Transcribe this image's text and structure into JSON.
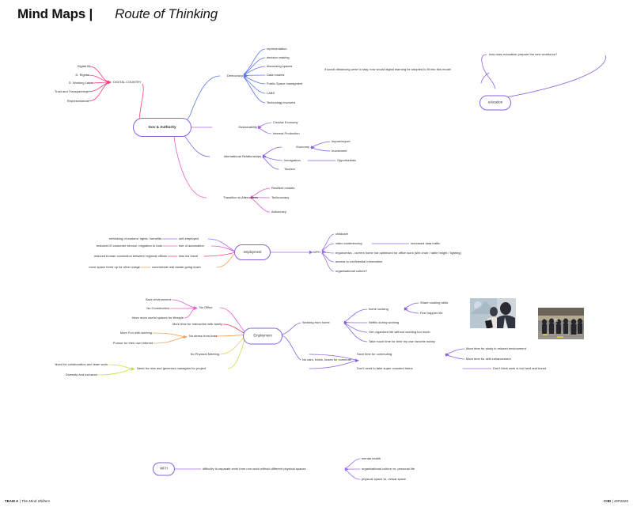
{
  "header": {
    "title": "Mind Maps |",
    "subtitle": "Route of Thinking"
  },
  "footer": {
    "left_bold": "TEAM A",
    "left_sep": " | ",
    "left_italic": "The Mind Shifters",
    "right_bold": "CIID",
    "right_sep": " | ",
    "right_italic": "IDP2020"
  },
  "colors": {
    "pink": "#ef3d7d",
    "magenta": "#e45fd0",
    "blue": "#5b76e8",
    "violet": "#8a62e0",
    "purple": "#9b6ee8",
    "orange": "#f0a25e",
    "yellow": "#e8d44a",
    "lime": "#c8dd45",
    "node_border": "#8a62e0",
    "text": "#262626"
  },
  "nodes": {
    "gov_authority": "Gov & Authority",
    "education": "education",
    "employment_mid": "employment",
    "employment_low": "Employment",
    "wfh_bottom": "WFH"
  },
  "map1": {
    "digital_country": "DIGITAL COUNTRY",
    "digital_country_children": [
      "Digital ID",
      "D. Rights",
      "D. Working Laws",
      "Trust and Transparency",
      "Representation"
    ],
    "democracy": "Democracy",
    "democracy_children": [
      "representation",
      "decision making",
      "discussing spaces",
      "Data models",
      "Public Space managment",
      "LABS",
      "Technology involved"
    ],
    "sustainability": "Sustainability",
    "sustainability_children": [
      "Circular Economy",
      "Internal Production"
    ],
    "international_relationships": "International Relationships",
    "economy": "Economy",
    "economy_children": [
      "Import/export",
      "Investment"
    ],
    "immigration": "Immigration",
    "immigration_child": "Opportunities",
    "tourism": "Tourism",
    "transition_to_alternatives": "Transition to Alternatives",
    "transition_children": [
      "Resilient models",
      "Technocracy",
      "Adhocracy"
    ],
    "note_social_distancing": "if social distancing were to stay, how would digital learning be adopted to fit into this model",
    "note_education_workforce": "how does education prepare the new workforce?"
  },
  "map2": {
    "employment": "employment",
    "left_pairs": [
      {
        "outer": "rethinking of workers' rights / benefits",
        "inner": "self-employed"
      },
      {
        "outer": "reduced f2f customer service, migration to bots",
        "inner": "rise of automation"
      },
      {
        "outer": "reduced human connection between regional offices",
        "inner": "less biz travel"
      },
      {
        "outer": "more space freed up for other usage",
        "inner": "commercial real estate going down"
      }
    ],
    "wfh": "WFH",
    "wfh_children": [
      "childcare",
      "video conferencing",
      "ergonomics - current home not optimised for office work (shit chair / table height / lighting)",
      "access to confidential information",
      "organisational culture?"
    ],
    "video_conferencing_child": "increased data traffic"
  },
  "map3": {
    "employment": "Employment",
    "no_office": "No Office",
    "no_office_children": [
      "Save environment",
      "No Construction",
      "Have more useful spaces for lifestyle"
    ],
    "more_time_family": "More time for interaction with family",
    "no_stress_from_boss": "No stress from boss",
    "no_stress_children": [
      "More Fun with working",
      "Pursue for their own interest"
    ],
    "no_physical_meeting": "No Physical Meeting",
    "need_managers": "Need for nice and generous managers for project",
    "need_managers_children": [
      "Need for collaboration and team work",
      "Diversity and Inclusion"
    ],
    "working_from_home": "Working from home",
    "wfh_children": [
      "home cooking",
      "Netflix during working",
      "Get organized life without working too much",
      "Take much time for their my own favorite hobby"
    ],
    "home_cooking_children": [
      "Share cooking skills",
      "Feel happier life"
    ],
    "no_commute": "No cars, trains, buses for commute",
    "save_time_commuting": "Save time for commuting",
    "save_time_children": [
      "More time for study in relaxed environment",
      "More time for skill enhancement"
    ],
    "no_crowded_trains": "Don't need to take super crowded trains",
    "no_crowded_child": "Don't think work is too hard and bored",
    "photos": [
      {
        "name": "photo-office-meeting"
      },
      {
        "name": "photo-crowded-commuters"
      }
    ]
  },
  "map4": {
    "wfh": "WFH",
    "main": "difficulty to separate work from non-work without different physical spaces",
    "children": [
      "mental health",
      "organisational culture vs. personal life",
      "physical space vs. virtual space"
    ]
  }
}
